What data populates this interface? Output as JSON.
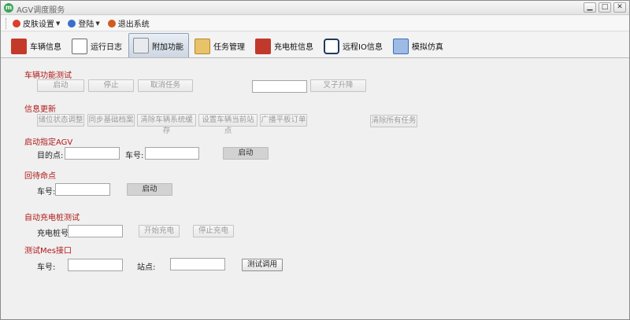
{
  "window": {
    "title": "AGV调度服务"
  },
  "menu": [
    {
      "label": "皮肤设置",
      "icon": "palette-icon",
      "color": "#d9402b",
      "has_caret": true
    },
    {
      "label": "登陆",
      "icon": "login-icon",
      "color": "#3a6fc9",
      "has_caret": true
    },
    {
      "label": "退出系统",
      "icon": "exit-icon",
      "color": "#d25a1d",
      "has_caret": false
    }
  ],
  "tabs": [
    {
      "label": "车辆信息",
      "icon": "vehicle-icon",
      "color": "#c43a2a"
    },
    {
      "label": "运行日志",
      "icon": "log-icon",
      "color": "#6b6b6b"
    },
    {
      "label": "附加功能",
      "icon": "addon-icon",
      "color": "#8a8f98",
      "active": true
    },
    {
      "label": "任务管理",
      "icon": "task-icon",
      "color": "#b8862c"
    },
    {
      "label": "充电桩信息",
      "icon": "charger-icon",
      "color": "#c0392b"
    },
    {
      "label": "远程IO信息",
      "icon": "remote-io-icon",
      "color": "#1f3a5f"
    },
    {
      "label": "模拟仿真",
      "icon": "simulation-icon",
      "color": "#3d6fb8"
    }
  ],
  "sections": {
    "vehicle_test": {
      "title": "车辆功能测试",
      "start": "启动",
      "stop": "停止",
      "cancel_task": "取消任务",
      "fork_value": "",
      "fork_lift": "叉子升降"
    },
    "info_update": {
      "title": "信息更新",
      "buttons": [
        "储位状态调整",
        "同步基础档案",
        "清除车辆系统缓存",
        "设置车辆当前站点",
        "广播平板订单"
      ],
      "clear_all": "清除所有任务"
    },
    "start_agv": {
      "title": "启动指定AGV",
      "dest_label": "目的点:",
      "dest_value": "",
      "car_label": "车号:",
      "car_value": "",
      "start": "启动"
    },
    "return_standby": {
      "title": "回待命点",
      "car_label": "车号:",
      "car_value": "",
      "start": "启动"
    },
    "charger_test": {
      "title": "自动充电桩测试",
      "pile_label": "充电桩号:",
      "pile_value": "",
      "start_charge": "开始充电",
      "stop_charge": "停止充电"
    },
    "mes_test": {
      "title": "测试Mes接口",
      "car_label": "车号:",
      "car_value": "",
      "station_label": "站点:",
      "station_value": "",
      "test_call": "测试调用"
    }
  }
}
